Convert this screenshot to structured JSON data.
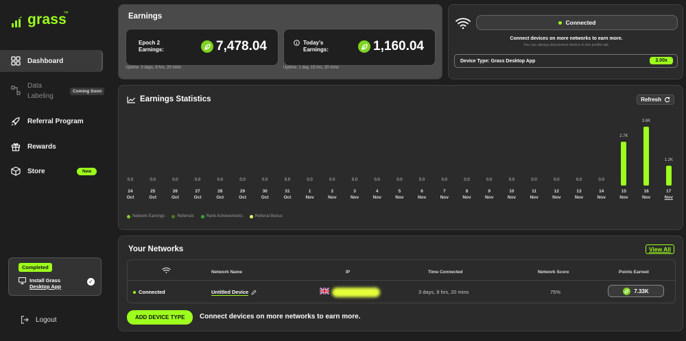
{
  "brand": {
    "name": "grass",
    "tm": "™",
    "accent": "#9dff1c"
  },
  "sidebar": {
    "items": [
      {
        "label": "Dashboard",
        "icon": "grid-icon"
      },
      {
        "label": "Data",
        "label2": "Labeling",
        "badge": "Coming Soon",
        "icon": "data-labeling-icon"
      },
      {
        "label": "Referral Program",
        "icon": "rocket-icon"
      },
      {
        "label": "Rewards",
        "icon": "gift-icon"
      },
      {
        "label": "Store",
        "badge": "New",
        "icon": "cube-icon"
      }
    ],
    "install": {
      "status": "Completed",
      "line1": "Install Grass",
      "line2": "Desktop App"
    },
    "logout": "Logout"
  },
  "earnings": {
    "title": "Earnings",
    "epoch": {
      "label1": "Epoch 2",
      "label2": "Earnings:",
      "value": "7,478.04",
      "uptime": "Uptime: 3 days, 9 hrs, 20 mins"
    },
    "today": {
      "label1": "Today's",
      "label2": "Earnings:",
      "value": "1,160.04",
      "uptime": "Uptime: 1 day, 15 hrs, 20 mins"
    }
  },
  "connection": {
    "status": "Connected",
    "msg": "Connect devices on more networks to earn more.",
    "sub": "You can always disconnect device in the profile tab.",
    "device_type": "Device Type: Grass Desktop App",
    "multiplier": "2.00x"
  },
  "stats": {
    "title": "Earnings Statistics",
    "refresh": "Refresh"
  },
  "chart_data": {
    "type": "bar",
    "title": "Earnings Statistics",
    "categories": [
      "24 Oct",
      "25 Oct",
      "26 Oct",
      "27 Oct",
      "28 Oct",
      "29 Oct",
      "30 Oct",
      "31 Oct",
      "1 Nov",
      "2 Nov",
      "3 Nov",
      "4 Nov",
      "5 Nov",
      "6 Nov",
      "7 Nov",
      "8 Nov",
      "9 Nov",
      "10 Nov",
      "11 Nov",
      "12 Nov",
      "13 Nov",
      "14 Nov",
      "15 Nov",
      "16 Nov",
      "17 Nov"
    ],
    "days": [
      "24",
      "25",
      "26",
      "27",
      "28",
      "29",
      "30",
      "31",
      "1",
      "2",
      "3",
      "4",
      "5",
      "6",
      "7",
      "8",
      "9",
      "10",
      "11",
      "12",
      "13",
      "14",
      "15",
      "16",
      "17"
    ],
    "months": [
      "Oct",
      "Oct",
      "Oct",
      "Oct",
      "Oct",
      "Oct",
      "Oct",
      "Oct",
      "Nov",
      "Nov",
      "Nov",
      "Nov",
      "Nov",
      "Nov",
      "Nov",
      "Nov",
      "Nov",
      "Nov",
      "Nov",
      "Nov",
      "Nov",
      "Nov",
      "Nov",
      "Nov",
      "Nov"
    ],
    "values": [
      0,
      0,
      0,
      0,
      0,
      0,
      0,
      0,
      0,
      0,
      0,
      0,
      0,
      0,
      0,
      0,
      0,
      0,
      0,
      0,
      0,
      0,
      2700,
      3600,
      1200
    ],
    "labels": [
      "0.0",
      "0.0",
      "0.0",
      "0.0",
      "0.0",
      "0.0",
      "0.0",
      "0.0",
      "0.0",
      "0.0",
      "0.0",
      "0.0",
      "0.0",
      "0.0",
      "0.0",
      "0.0",
      "0.0",
      "0.0",
      "0.0",
      "0.0",
      "0.0",
      "0.0",
      "2.7K",
      "3.6K",
      "1.2K"
    ],
    "legend": [
      {
        "name": "Network Earnings",
        "color": "#7ed321"
      },
      {
        "name": "Referrals",
        "color": "#4a7a1e"
      },
      {
        "name": "Rank Achievements",
        "color": "#3fa83f"
      },
      {
        "name": "Referral Bonus",
        "color": "#e8ff6a"
      }
    ],
    "ylim": [
      0,
      3600
    ],
    "legend_position": "bottom-left",
    "grid": false
  },
  "networks": {
    "title": "Your Networks",
    "view_all": "View All",
    "headers": {
      "name": "Network Name",
      "ip": "IP",
      "time": "Time Connected",
      "score": "Network Score",
      "points": "Points Earned"
    },
    "row": {
      "status": "Connected",
      "name": "Untitled Device",
      "time": "3 days, 9 hrs, 20 mins",
      "score": "75%",
      "points": "7.33K"
    },
    "add_button": "ADD DEVICE TYPE",
    "add_msg": "Connect devices on more networks to earn more."
  }
}
